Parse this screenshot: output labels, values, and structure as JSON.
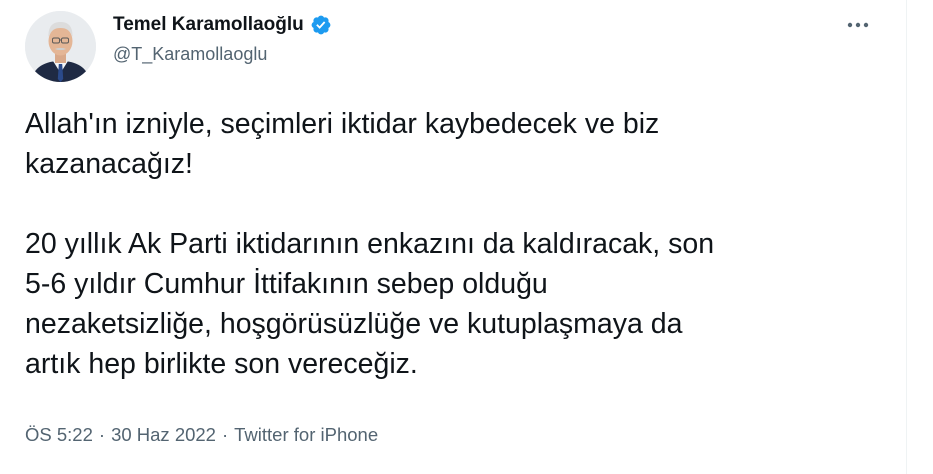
{
  "author": {
    "display_name": "Temel Karamollaoğlu",
    "handle": "@T_Karamollaoglu",
    "verified": true
  },
  "tweet": {
    "paragraph1_line1": "Allah'ın izniyle, seçimleri iktidar kaybedecek ve biz",
    "paragraph1_line2": "kazanacağız!",
    "paragraph2_line1": "20 yıllık Ak Parti iktidarının enkazını da kaldıracak, son",
    "paragraph2_line2": "5-6 yıldır Cumhur İttifakının sebep olduğu",
    "paragraph2_line3": "nezaketsizliğe, hoşgörüsüzlüğe ve kutuplaşmaya da",
    "paragraph2_line4": "artık hep birlikte son vereceğiz."
  },
  "meta": {
    "time": "ÖS 5:22",
    "separator": "·",
    "date": "30 Haz 2022",
    "source": "Twitter for iPhone"
  },
  "icons": {
    "verified": "verified-badge-icon",
    "more": "more-options-icon"
  },
  "colors": {
    "text_primary": "#0f1419",
    "text_secondary": "#536471",
    "verified_blue": "#1d9bf0"
  }
}
